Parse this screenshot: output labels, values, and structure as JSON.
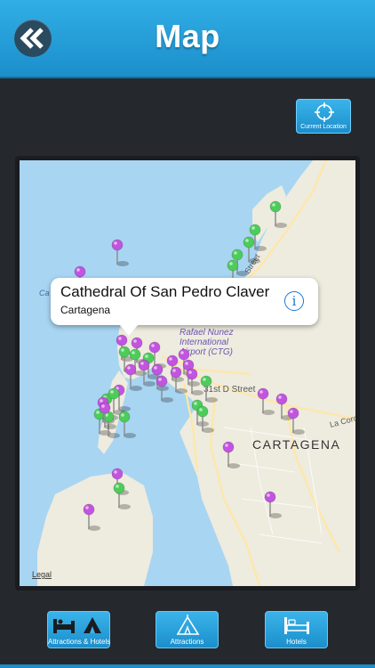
{
  "header": {
    "title": "Map"
  },
  "current_location": {
    "label": "Current Location"
  },
  "map": {
    "street_label": "31st D Street",
    "diagonal_street": "Street",
    "road_label": "La Cord",
    "city_label": "CARTAGENA",
    "airport_label": "Rafael Nunez International Airport (CTG)",
    "airport_line1": "Rafael Nunez",
    "airport_line2": "International",
    "airport_line3": "Airport (CTG)",
    "bay_label": "Ca",
    "legal": "Legal",
    "water_color": "#a8d5f2",
    "land_color": "#eeebdf",
    "pin_purple": "#c254e0",
    "pin_green": "#4ccd5a"
  },
  "callout": {
    "title": "Cathedral Of San Pedro Claver",
    "subtitle": "Cartagena"
  },
  "tabs": [
    {
      "label": "Attractions & Hotels"
    },
    {
      "label": "Attractions"
    },
    {
      "label": "Hotels"
    }
  ]
}
